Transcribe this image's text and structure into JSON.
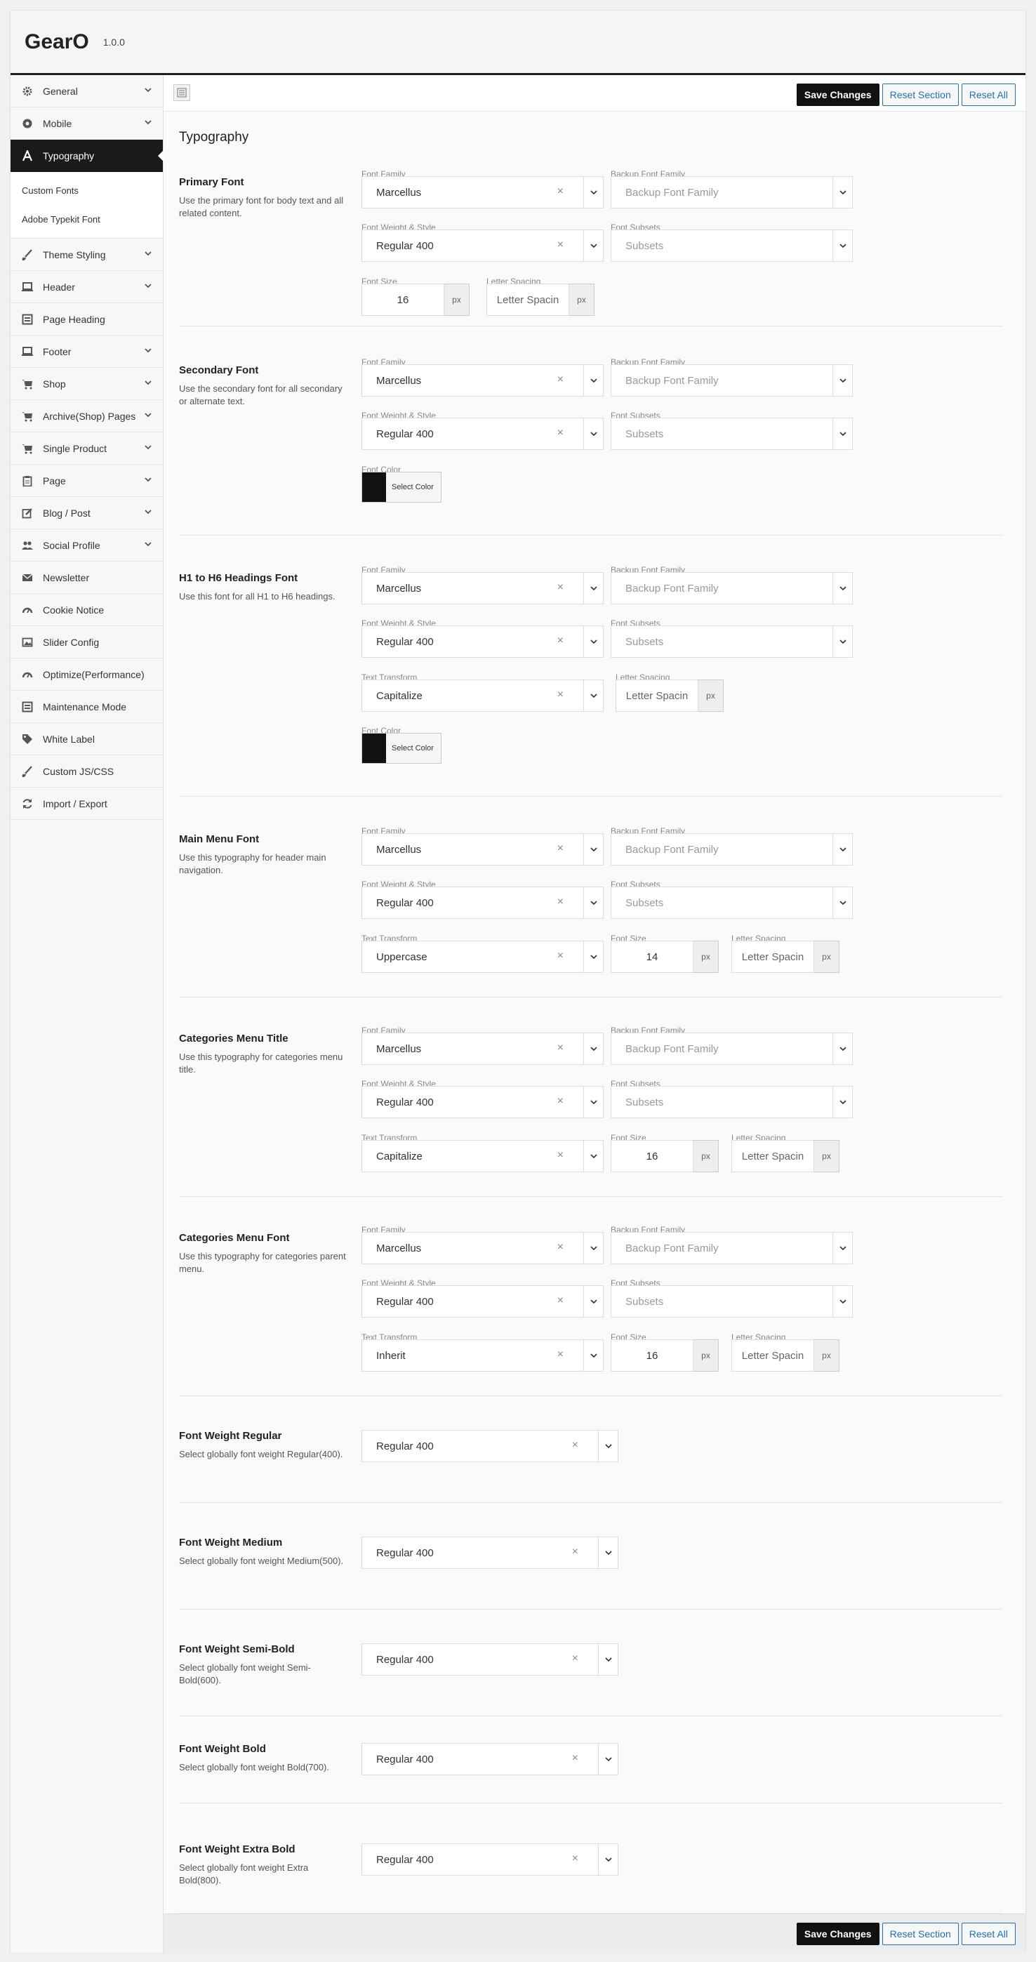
{
  "app": {
    "title": "GearO",
    "version": "1.0.0"
  },
  "toolbar": {
    "save": "Save Changes",
    "reset_section": "Reset Section",
    "reset_all": "Reset All"
  },
  "sidebar": {
    "items": [
      {
        "label": "General",
        "icon": "gear-icon"
      },
      {
        "label": "Mobile",
        "icon": "mobile-icon"
      },
      {
        "label": "Typography",
        "icon": "font-icon"
      },
      {
        "label": "Theme Styling",
        "icon": "brush-icon"
      },
      {
        "label": "Header",
        "icon": "laptop-icon"
      },
      {
        "label": "Page Heading",
        "icon": "window-icon"
      },
      {
        "label": "Footer",
        "icon": "laptop-icon"
      },
      {
        "label": "Shop",
        "icon": "cart-icon"
      },
      {
        "label": "Archive(Shop) Pages",
        "icon": "cart-icon"
      },
      {
        "label": "Single Product",
        "icon": "cart-icon"
      },
      {
        "label": "Page",
        "icon": "clipboard-icon"
      },
      {
        "label": "Blog / Post",
        "icon": "edit-icon"
      },
      {
        "label": "Social Profile",
        "icon": "users-icon"
      },
      {
        "label": "Newsletter",
        "icon": "envelope-icon"
      },
      {
        "label": "Cookie Notice",
        "icon": "gauge-icon"
      },
      {
        "label": "Slider Config",
        "icon": "image-icon"
      },
      {
        "label": "Optimize(Performance)",
        "icon": "gauge-icon"
      },
      {
        "label": "Maintenance Mode",
        "icon": "window-icon"
      },
      {
        "label": "White Label",
        "icon": "tag-icon"
      },
      {
        "label": "Custom JS/CSS",
        "icon": "brush-icon"
      },
      {
        "label": "Import / Export",
        "icon": "refresh-icon"
      }
    ],
    "sub_items": [
      "Custom Fonts",
      "Adobe Typekit Font"
    ]
  },
  "labels": {
    "font_family": "Font Family",
    "backup_font_family": "Backup Font Family",
    "font_weight_style": "Font Weight & Style",
    "font_subsets": "Font Subsets",
    "font_size": "Font Size",
    "letter_spacing": "Letter Spacing",
    "font_color": "Font Color",
    "text_transform": "Text Transform",
    "select_color": "Select Color",
    "px": "px"
  },
  "placeholders": {
    "backup_font_family": "Backup Font Family",
    "subsets": "Subsets",
    "letter_spacing": "Letter Spacin"
  },
  "section": {
    "title": "Typography",
    "primary": {
      "title": "Primary Font",
      "desc": "Use the primary font for body text and all related content.",
      "family": "Marcellus",
      "weight": "Regular 400",
      "size": "16"
    },
    "secondary": {
      "title": "Secondary Font",
      "desc": "Use the secondary font for all secondary or alternate text.",
      "family": "Marcellus",
      "weight": "Regular 400"
    },
    "headings": {
      "title": "H1 to H6 Headings Font",
      "desc": "Use this font for all H1 to H6 headings.",
      "family": "Marcellus",
      "weight": "Regular 400",
      "transform": "Capitalize"
    },
    "main_menu": {
      "title": "Main Menu Font",
      "desc": "Use this typography for header main navigation.",
      "family": "Marcellus",
      "weight": "Regular 400",
      "transform": "Uppercase",
      "size": "14"
    },
    "cat_title": {
      "title": "Categories Menu Title",
      "desc": "Use this typography for categories menu title.",
      "family": "Marcellus",
      "weight": "Regular 400",
      "transform": "Capitalize",
      "size": "16"
    },
    "cat_font": {
      "title": "Categories Menu Font",
      "desc": "Use this typography for categories parent menu.",
      "family": "Marcellus",
      "weight": "Regular 400",
      "transform": "Inherit",
      "size": "16"
    },
    "fw_regular": {
      "title": "Font Weight Regular",
      "desc": "Select globally font weight Regular(400).",
      "value": "Regular 400"
    },
    "fw_medium": {
      "title": "Font Weight Medium",
      "desc": "Select globally font weight Medium(500).",
      "value": "Regular 400"
    },
    "fw_semibold": {
      "title": "Font Weight Semi-Bold",
      "desc": "Select globally font weight Semi-Bold(600).",
      "value": "Regular 400"
    },
    "fw_bold": {
      "title": "Font Weight Bold",
      "desc": "Select globally font weight Bold(700).",
      "value": "Regular 400"
    },
    "fw_extrabold": {
      "title": "Font Weight Extra Bold",
      "desc": "Select globally font weight Extra Bold(800).",
      "value": "Regular 400"
    }
  },
  "colors": {
    "accent": "#111111",
    "link": "#2271b1",
    "font_color_swatch": "#111111"
  }
}
